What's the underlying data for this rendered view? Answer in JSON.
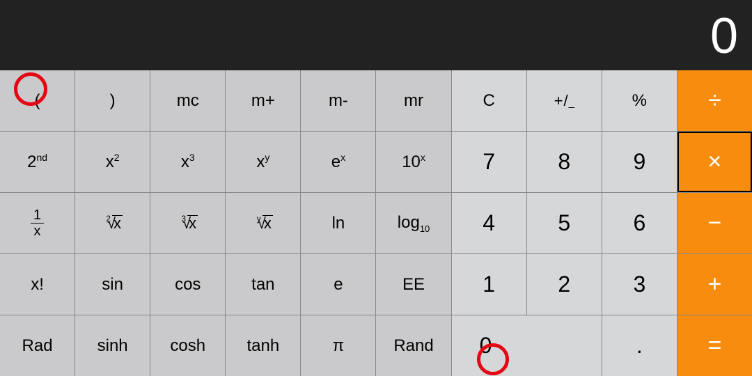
{
  "display": {
    "value": "0"
  },
  "keys": {
    "open_paren": "(",
    "close_paren": ")",
    "mc": "mc",
    "m_plus": "m+",
    "m_minus": "m-",
    "mr": "mr",
    "clear": "C",
    "sign_plus": "+",
    "sign_slash": "/",
    "sign_minus": "_",
    "percent": "%",
    "divide": "÷",
    "second_base": "2",
    "second_sup": "nd",
    "x2_base": "x",
    "x2_sup": "2",
    "x3_base": "x",
    "x3_sup": "3",
    "xy_base": "x",
    "xy_sup": "y",
    "ex_base": "e",
    "ex_sup": "x",
    "tenx_base": "10",
    "tenx_sup": "x",
    "seven": "7",
    "eight": "8",
    "nine": "9",
    "multiply": "×",
    "recip_top": "1",
    "recip_bot": "x",
    "root2_idx": "2",
    "root2_x": "x",
    "root3_idx": "3",
    "root3_x": "x",
    "rooty_idx": "y",
    "rooty_x": "x",
    "ln": "ln",
    "log10_base": "log",
    "log10_sub": "10",
    "four": "4",
    "five": "5",
    "six": "6",
    "minus": "−",
    "factorial": "x!",
    "sin": "sin",
    "cos": "cos",
    "tan": "tan",
    "e": "e",
    "ee": "EE",
    "one": "1",
    "two": "2",
    "three": "3",
    "plus": "+",
    "rad": "Rad",
    "sinh": "sinh",
    "cosh": "cosh",
    "tanh": "tanh",
    "pi": "π",
    "rand": "Rand",
    "zero": "0",
    "decimal": ".",
    "equals": "="
  }
}
